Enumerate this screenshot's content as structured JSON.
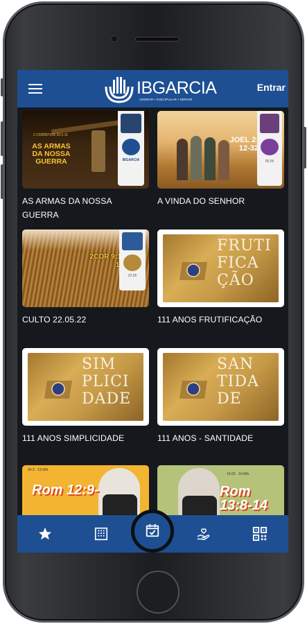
{
  "header": {
    "logo_text": "IBGARCIA",
    "logo_subtext": "ADORAR • DISCIPULAR • SERVIR",
    "login_label": "Entrar"
  },
  "cards": [
    {
      "title": "AS ARMAS DA NOSSA GUERRA",
      "thumb_text_1": "2 CORÍNTIOS 10:1-11",
      "thumb_text_2": "AS ARMAS DA NOSSA GUERRA",
      "thumb_badge": "IBGARCIA"
    },
    {
      "title": "A VINDA DO SENHOR",
      "thumb_text_1": "JOEL 2: 12-32",
      "thumb_text_2": "05.06"
    },
    {
      "title": "CULTO 22.05.22",
      "thumb_text_1": "2COR 9:1-15",
      "thumb_text_2": "22.05"
    },
    {
      "title": "111 ANOS FRUTIFICAÇÃO",
      "thumb_word": [
        "FRUTI",
        "FICA",
        "ÇÃO"
      ]
    },
    {
      "title": "111 ANOS SIMPLICIDADE",
      "thumb_word": [
        "SIM",
        "PLICI",
        "DADE"
      ]
    },
    {
      "title": "111 ANOS - SANTIDADE",
      "thumb_word": [
        "SAN",
        "TIDA",
        "DE"
      ]
    },
    {
      "title": "",
      "thumb_text_1": "Rom 12:9-",
      "thumb_text_2": "24.2 · 19:30h"
    },
    {
      "title": "",
      "thumb_text_1": "Rom 13:8-14",
      "thumb_text_2": "14.03 · 10:40h"
    }
  ],
  "bottom_nav": [
    {
      "icon": "star-icon"
    },
    {
      "icon": "building-icon"
    },
    {
      "icon": "calendar-check-icon"
    },
    {
      "icon": "hand-heart-icon"
    },
    {
      "icon": "qr-code-icon"
    }
  ],
  "colors": {
    "bar_blue": "#1e4f93",
    "background": "#15181d",
    "gold": "#c69a47"
  }
}
